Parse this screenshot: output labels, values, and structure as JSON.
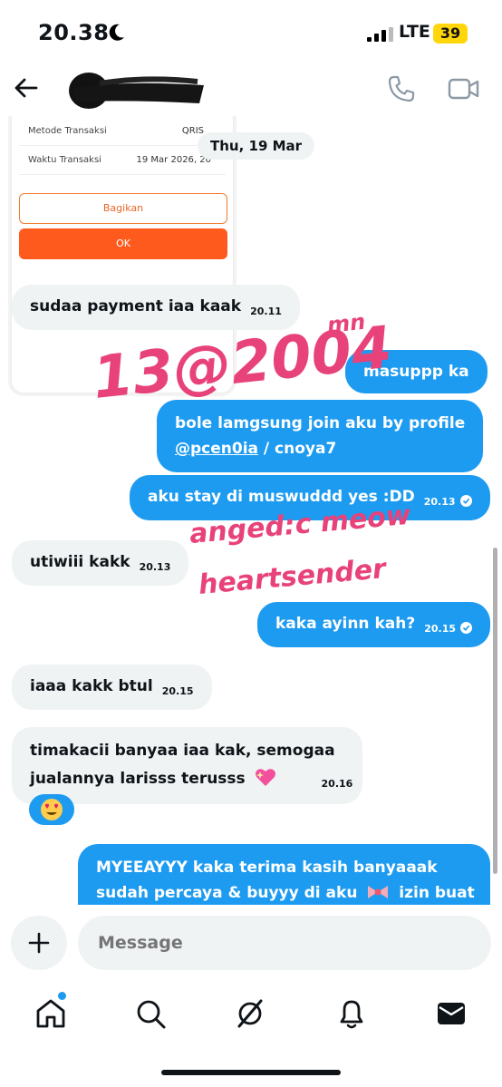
{
  "status_bar": {
    "time": "20.38",
    "network": "LTE",
    "battery": "39"
  },
  "header": {
    "back_icon": "arrow-left-icon",
    "call_icon": "phone-icon",
    "video_icon": "video-camera-icon"
  },
  "receipt": {
    "rows": [
      {
        "label": "Metode Transaksi",
        "value": "QRIS"
      },
      {
        "label": "Waktu Transaksi",
        "value": "19 Mar 2026, 20"
      }
    ],
    "share_button": "Bagikan",
    "ok_button": "OK"
  },
  "date_separator": "Thu, 19 Mar",
  "messages": [
    {
      "text": "sudaa payment iaa kaak",
      "time": "20.11"
    },
    {
      "text": "masuppp ka"
    },
    {
      "line1": "bole lamgsung join aku by profile",
      "mention": "@pcen0ia",
      "line2_rest": " / cnoya7"
    },
    {
      "text": "aku stay di muswuddd yes :DD",
      "time": "20.13"
    },
    {
      "text": "utiwiii kakk",
      "time": "20.13"
    },
    {
      "text": "kaka ayinn kah?",
      "time": "20.15"
    },
    {
      "text": "iaaa kakk btul",
      "time": "20.15"
    },
    {
      "line1": "timakacii banyaa iaa kak, semogaa",
      "line2": "jualannya larisss terusss",
      "time": "20.16"
    },
    {
      "line1": "MYEEAYYY kaka terima kasih banyaaak",
      "line2": "sudah percaya & buyyy di aku",
      "line2_tail": "izin buat"
    }
  ],
  "handwriting": [
    "13@2004",
    "mn",
    "anged:c meow",
    "heartsender"
  ],
  "colors": {
    "accent": "#1d9bf0",
    "bubble_in": "#eff3f4",
    "ink": "#e8427a",
    "orange": "#fe5a1d"
  },
  "composer": {
    "placeholder": "Message"
  },
  "nav": [
    "home-icon",
    "search-icon",
    "grok-icon",
    "bell-icon",
    "mail-icon"
  ]
}
